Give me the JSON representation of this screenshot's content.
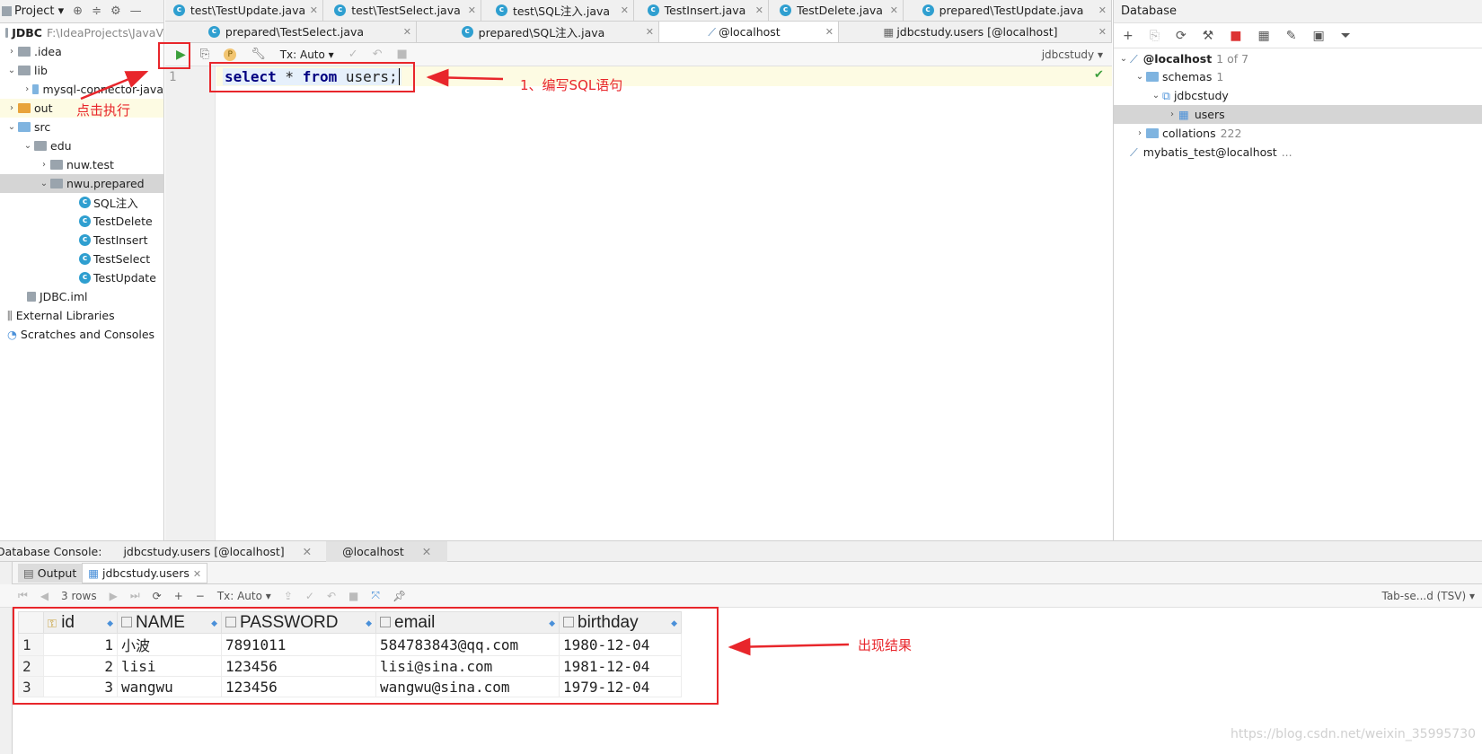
{
  "project": {
    "header_label": "Project",
    "root_name": "JDBC",
    "root_path": "F:\\IdeaProjects\\JavaV",
    "items": [
      {
        "label": ".idea"
      },
      {
        "label": "lib"
      },
      {
        "label": "mysql-connector-java"
      },
      {
        "label": "out"
      },
      {
        "label": "src"
      },
      {
        "label": "edu"
      },
      {
        "label": "nuw.test"
      },
      {
        "label": "nwu.prepared"
      },
      {
        "label": "SQL注入"
      },
      {
        "label": "TestDelete"
      },
      {
        "label": "TestInsert"
      },
      {
        "label": "TestSelect"
      },
      {
        "label": "TestUpdate"
      },
      {
        "label": "JDBC.iml"
      },
      {
        "label": "External Libraries"
      },
      {
        "label": "Scratches and Consoles"
      }
    ]
  },
  "tabs_row1": [
    "test\\TestUpdate.java",
    "test\\TestSelect.java",
    "test\\SQL注入.java",
    "TestInsert.java",
    "TestDelete.java",
    "prepared\\TestUpdate.java"
  ],
  "tabs_row2": [
    "prepared\\TestSelect.java",
    "prepared\\SQL注入.java",
    "@localhost",
    "jdbcstudy.users [@localhost]"
  ],
  "editor": {
    "tx_mode": "Tx: Auto",
    "schema": "jdbcstudy",
    "line_number": "1",
    "sql_kw1": "select",
    "sql_mid": " * ",
    "sql_kw2": "from",
    "sql_rest": " users;"
  },
  "database": {
    "title": "Database",
    "host": "@localhost",
    "host_count": "1 of 7",
    "schemas": "schemas",
    "schemas_count": "1",
    "db": "jdbcstudy",
    "table": "users",
    "collations": "collations",
    "collations_count": "222",
    "other": "mybatis_test@localhost",
    "other_suffix": "..."
  },
  "console": {
    "label": "Database Console:",
    "tab1": "jdbcstudy.users [@localhost]",
    "tab2": "@localhost",
    "output_tab": "Output",
    "result_tab": "jdbcstudy.users",
    "rows": "3 rows",
    "tx_mode": "Tx: Auto",
    "export": "Tab-se...d (TSV)"
  },
  "results": {
    "columns": [
      "id",
      "NAME",
      "PASSWORD",
      "email",
      "birthday"
    ],
    "rows": [
      [
        "1",
        "1",
        "小波",
        "7891011",
        "584783843@qq.com",
        "1980-12-04"
      ],
      [
        "2",
        "2",
        "lisi",
        "123456",
        "lisi@sina.com",
        "1981-12-04"
      ],
      [
        "3",
        "3",
        "wangwu",
        "123456",
        "wangwu@sina.com",
        "1979-12-04"
      ]
    ]
  },
  "annotations": {
    "click_run": "点击执行",
    "write_sql": "1、编写SQL语句",
    "result": "出现结果"
  },
  "watermark": "https://blog.csdn.net/weixin_35995730",
  "colors": {
    "annotation_red": "#e8262b",
    "keyword_blue": "#000080",
    "run_green": "#3c9f3c"
  }
}
